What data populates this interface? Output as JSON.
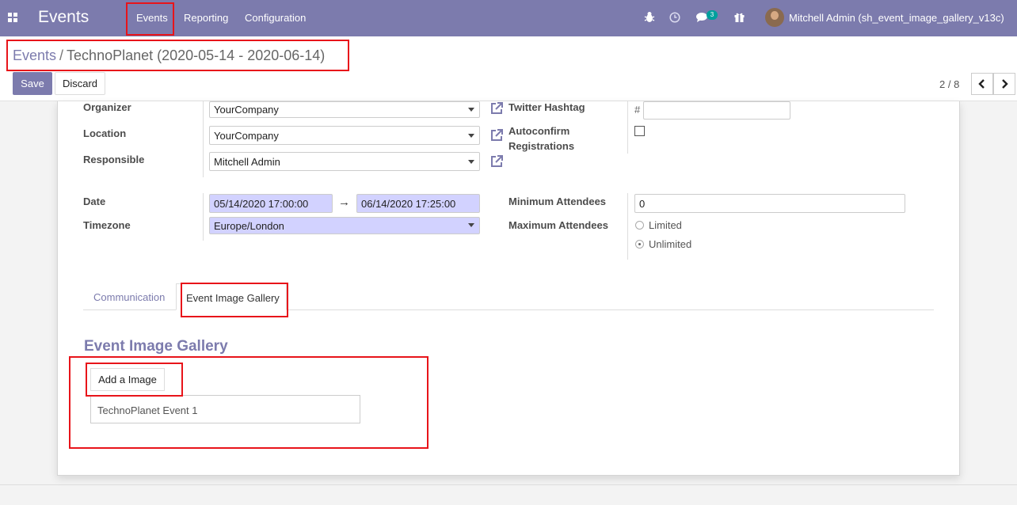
{
  "navbar": {
    "app_title": "Events",
    "menus": [
      "Events",
      "Reporting",
      "Configuration"
    ],
    "icons": [
      "bug-icon",
      "clock-icon",
      "chat-icon",
      "gift-icon"
    ],
    "message_count": "3",
    "user": "Mitchell Admin (sh_event_image_gallery_v13c)",
    "bg_color": "#7c7bad"
  },
  "breadcrumb": {
    "parent": "Events",
    "separator": "/",
    "current": "TechnoPlanet (2020-05-14 - 2020-06-14)"
  },
  "actions": {
    "save": "Save",
    "discard": "Discard"
  },
  "pager": {
    "value": "2 / 8",
    "prev_icon": "chevron-left-icon",
    "next_icon": "chevron-right-icon"
  },
  "form": {
    "organizer": {
      "label": "Organizer",
      "value": "YourCompany"
    },
    "location": {
      "label": "Location",
      "value": "YourCompany"
    },
    "responsible": {
      "label": "Responsible",
      "value": "Mitchell Admin"
    },
    "twitter": {
      "label": "Twitter Hashtag",
      "prefix": "#",
      "value": ""
    },
    "autoconfirm": {
      "label_line1": "Autoconfirm",
      "label_line2": "Registrations",
      "checked": false
    },
    "date": {
      "label": "Date",
      "start": "05/14/2020 17:00:00",
      "end": "06/14/2020 17:25:00",
      "arrow": "→"
    },
    "timezone": {
      "label": "Timezone",
      "value": "Europe/London"
    },
    "min_attendees": {
      "label": "Minimum Attendees",
      "value": "0"
    },
    "max_attendees": {
      "label": "Maximum Attendees",
      "options": [
        "Limited",
        "Unlimited"
      ],
      "selected": "Unlimited"
    }
  },
  "tabs": [
    {
      "label": "Communication",
      "active": false
    },
    {
      "label": "Event Image Gallery",
      "active": true
    }
  ],
  "gallery": {
    "title": "Event Image Gallery",
    "add_button": "Add a Image",
    "items": [
      "TechnoPlanet Event 1"
    ]
  },
  "colors": {
    "accent": "#7c7bad",
    "required_bg": "#d2d2ff",
    "highlight": "#e8141a"
  }
}
